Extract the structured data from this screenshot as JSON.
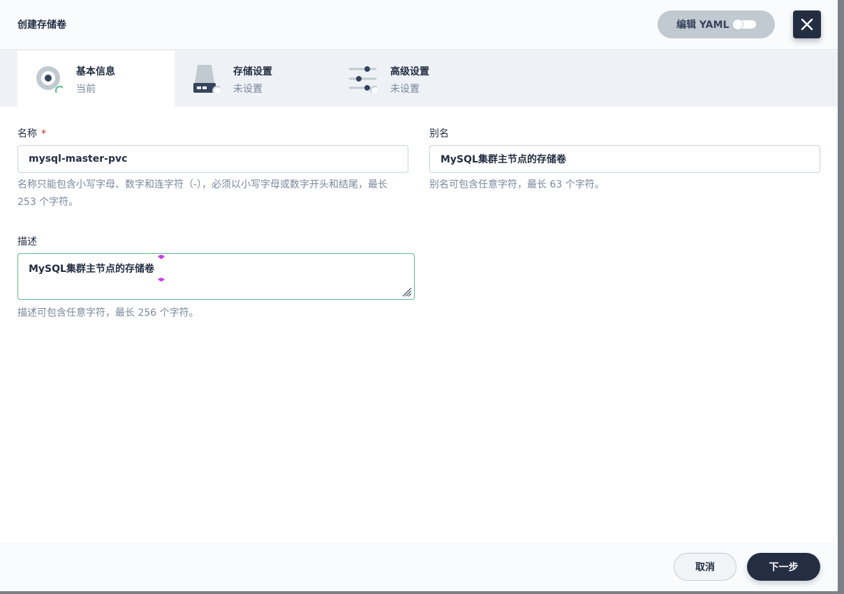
{
  "header": {
    "title": "创建存储卷",
    "yaml_label": "编辑 YAML"
  },
  "tabs": [
    {
      "name": "基本信息",
      "status": "当前"
    },
    {
      "name": "存储设置",
      "status": "未设置"
    },
    {
      "name": "高级设置",
      "status": "未设置"
    }
  ],
  "form": {
    "name": {
      "label": "名称",
      "required_mark": "*",
      "value": "mysql-master-pvc",
      "hint": "名称只能包含小写字母、数字和连字符（-），必须以小写字母或数字开头和结尾，最长 253 个字符。"
    },
    "alias": {
      "label": "别名",
      "value": "MySQL集群主节点的存储卷",
      "hint": "别名可包含任意字符，最长 63 个字符。"
    },
    "description": {
      "label": "描述",
      "value": "MySQL集群主节点的存储卷",
      "hint": "描述可包含任意字符，最长 256 个字符。"
    }
  },
  "footer": {
    "cancel_label": "取消",
    "next_label": "下一步"
  },
  "colors": {
    "primary": "#242e42",
    "success": "#55bc8a",
    "danger": "#ca2621",
    "muted_text": "#79879c"
  }
}
